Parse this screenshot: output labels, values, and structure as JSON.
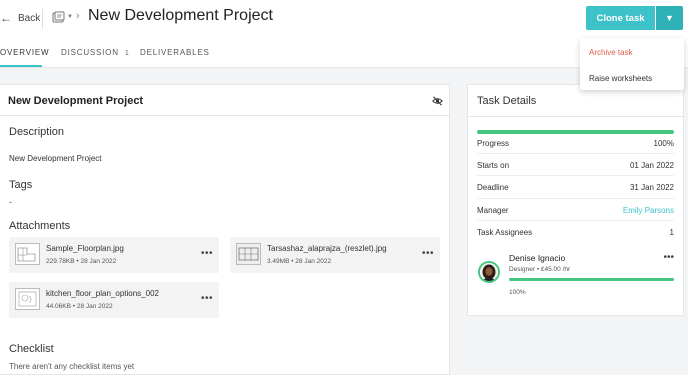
{
  "header": {
    "back_label": "Back",
    "title": "New Development Project",
    "clone_label": "Clone task"
  },
  "tabs": [
    {
      "label": "OVERVIEW"
    },
    {
      "label": "DISCUSSION",
      "count": "1"
    },
    {
      "label": "DELIVERABLES"
    }
  ],
  "dropdown": {
    "items": [
      {
        "label": "Archive task",
        "color": "#e05c4a"
      },
      {
        "label": "Raise worksheets"
      }
    ]
  },
  "main": {
    "card_title": "New Development Project",
    "description_heading": "Description",
    "description_text": "New Development Project",
    "tags_heading": "Tags",
    "tags_value": "-",
    "attachments_heading": "Attachments",
    "attachments": [
      {
        "name": "Sample_Floorplan.jpg",
        "size": "229.78KB",
        "date": "28 Jan 2022"
      },
      {
        "name": "Tarsashaz_alaprajza_(reszlet).jpg",
        "size": "3.49MB",
        "date": "28 Jan 2022"
      },
      {
        "name": "kitchen_floor_plan_options_002",
        "size": "44.06KB",
        "date": "28 Jan 2022"
      }
    ],
    "checklist_heading": "Checklist",
    "checklist_empty": "There aren't any checklist items yet"
  },
  "task_details": {
    "title": "Task Details",
    "progress_label": "Progress",
    "progress_value": "100%",
    "progress_fraction": 1.0,
    "starts_label": "Starts on",
    "starts_value": "01 Jan 2022",
    "deadline_label": "Deadline",
    "deadline_value": "31 Jan 2022",
    "manager_label": "Manager",
    "manager_value": "Emily Parsons",
    "assignees_label": "Task Assignees",
    "assignees_value": "1",
    "assignee": {
      "name": "Denise Ignacio",
      "role": "Designer",
      "rate": "£45.00 /hr",
      "progress": "100%"
    }
  },
  "colors": {
    "accent": "#3ec2c9",
    "progress": "#45c67f",
    "danger": "#e05c4a"
  }
}
